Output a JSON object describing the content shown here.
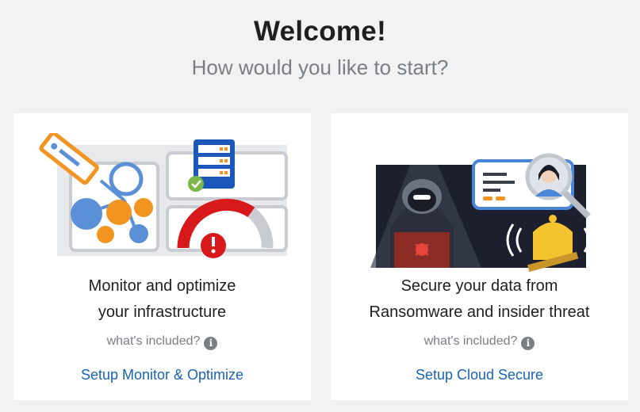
{
  "header": {
    "title": "Welcome!",
    "subtitle": "How would you like to start?"
  },
  "cards": [
    {
      "title_line1": "Monitor and optimize",
      "title_line2": "your infrastructure",
      "included_label": "what's included?",
      "info_icon": "info-icon",
      "link_label": "Setup Monitor & Optimize",
      "illustration": "infrastructure-monitoring-illustration"
    },
    {
      "title_line1": "Secure your data from",
      "title_line2": "Ransomware and insider threat",
      "included_label": "what's included?",
      "info_icon": "info-icon",
      "link_label": "Setup Cloud Secure",
      "illustration": "ransomware-security-illustration"
    }
  ],
  "colors": {
    "background": "#f2f2f2",
    "card": "#ffffff",
    "link": "#1a63b5",
    "muted": "#7a7f85",
    "orange": "#f29422",
    "blue": "#5b8fd6",
    "red": "#d7191c",
    "yellow": "#f4c430"
  }
}
